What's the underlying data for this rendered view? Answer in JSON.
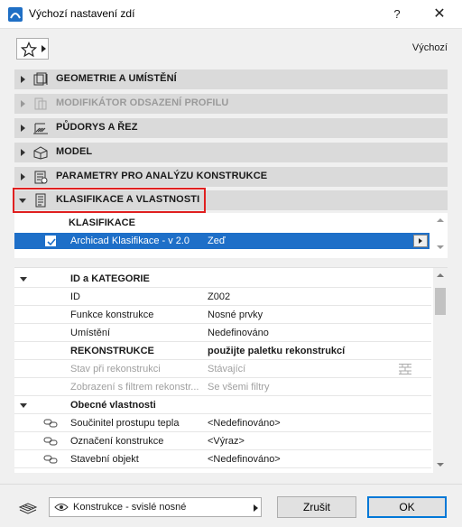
{
  "window": {
    "title": "Výchozí nastavení zdí",
    "help_label": "?",
    "close_label": "✕"
  },
  "favorites": {
    "icon": "star-icon",
    "right_label": "Výchozí"
  },
  "sections": [
    {
      "label": "GEOMETRIE A UMÍSTĚNÍ",
      "icon": "geometry-icon",
      "expanded": false,
      "enabled": true
    },
    {
      "label": "MODIFIKÁTOR ODSAZENÍ PROFILU",
      "icon": "profile-offset-icon",
      "expanded": false,
      "enabled": false
    },
    {
      "label": "PŮDORYS A ŘEZ",
      "icon": "floorplan-icon",
      "expanded": false,
      "enabled": true
    },
    {
      "label": "MODEL",
      "icon": "model-icon",
      "expanded": false,
      "enabled": true
    },
    {
      "label": "PARAMETRY PRO ANALÝZU KONSTRUKCE",
      "icon": "structural-analysis-icon",
      "expanded": false,
      "enabled": true
    },
    {
      "label": "KLASIFIKACE A VLASTNOSTI",
      "icon": "classification-icon",
      "expanded": true,
      "enabled": true
    }
  ],
  "classification": {
    "header": "KLASIFIKACE",
    "row": {
      "checked": true,
      "name": "Archicad Klasifikace - v 2.0",
      "value": "Zeď"
    }
  },
  "properties": [
    {
      "kind": "group",
      "name": "ID a KATEGORIE",
      "value": ""
    },
    {
      "kind": "item",
      "name": "ID",
      "value": "Z002"
    },
    {
      "kind": "item",
      "name": "Funkce konstrukce",
      "value": "Nosné prvky"
    },
    {
      "kind": "item",
      "name": "Umístění",
      "value": "Nedefinováno"
    },
    {
      "kind": "subgroup",
      "name": "REKONSTRUKCE",
      "value": "použijte paletku rekonstrukcí"
    },
    {
      "kind": "dim",
      "name": "Stav při rekonstrukci",
      "value": "Stávající"
    },
    {
      "kind": "dim",
      "name": "Zobrazení s filtrem rekonstr...",
      "value": "Se všemi filtry"
    },
    {
      "kind": "group",
      "name": "Obecné vlastnosti",
      "value": ""
    },
    {
      "kind": "linked",
      "name": "Součinitel prostupu tepla",
      "value": "<Nedefinováno>"
    },
    {
      "kind": "linked",
      "name": "Označení konstrukce",
      "value": "<Výraz>"
    },
    {
      "kind": "linked",
      "name": "Stavební objekt",
      "value": "<Nedefinováno>"
    }
  ],
  "footer": {
    "layer_label": "Konstrukce - svislé nosné",
    "cancel_label": "Zrušit",
    "ok_label": "OK"
  },
  "colors": {
    "selection": "#1e6fc8",
    "highlight_border": "#e02020",
    "ok_border": "#0078d7"
  }
}
